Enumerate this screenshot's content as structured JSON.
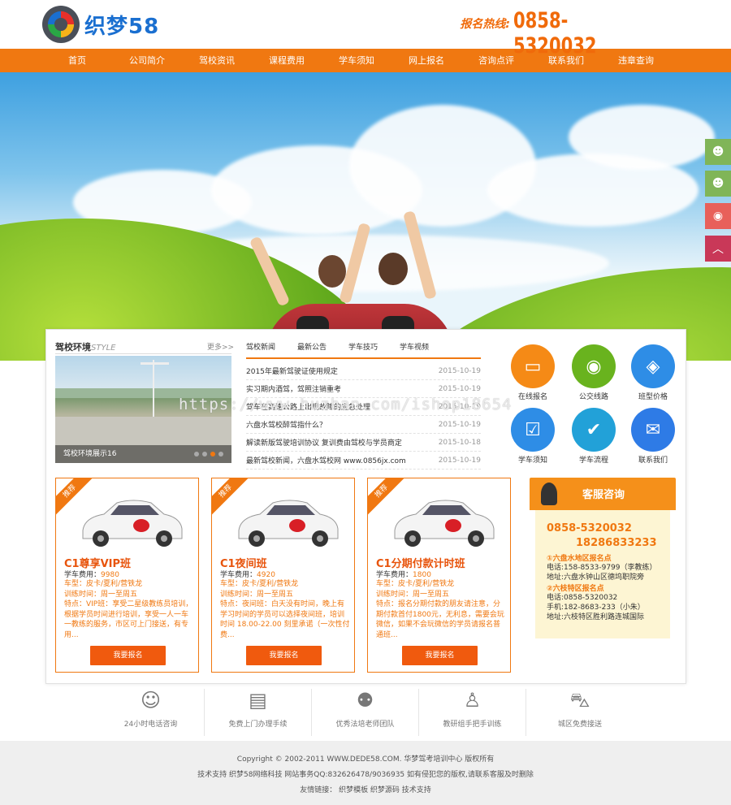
{
  "header": {
    "logo_text": "织梦58",
    "hotline_label": "报名热线:",
    "hotline_number": "0858-5320032"
  },
  "nav": {
    "items": [
      "首页",
      "公司简介",
      "驾校资讯",
      "课程费用",
      "学车须知",
      "网上报名",
      "咨询点评",
      "联系我们",
      "违章查询"
    ]
  },
  "environment": {
    "title": "驾校环境",
    "title_en": "STYLE",
    "more": "更多>>",
    "caption": "驾校环境展示16"
  },
  "news": {
    "tabs": [
      "驾校新闻",
      "最新公告",
      "学车技巧",
      "学车视频"
    ],
    "items": [
      {
        "title": "2015年最新驾驶证使用规定",
        "date": "2015-10-19"
      },
      {
        "title": "实习期内酒驾，驾照注销重考",
        "date": "2015-10-19"
      },
      {
        "title": "驾车在高速公路上出现故障的应急处理",
        "date": "2015-10-19"
      },
      {
        "title": "六盘水驾校醉驾指什么？",
        "date": "2015-10-19"
      },
      {
        "title": "解读新版驾驶培训协议 复训费由驾校与学员商定",
        "date": "2015-10-18"
      },
      {
        "title": "最新驾校新闻，六盘水驾校网 www.0856jx.com",
        "date": "2015-10-19"
      }
    ]
  },
  "quick_icons": [
    {
      "label": "在线报名",
      "color": "#f58a16"
    },
    {
      "label": "公交线路",
      "color": "#69b31e"
    },
    {
      "label": "班型价格",
      "color": "#2e8de6"
    },
    {
      "label": "学车须知",
      "color": "#2e8de6"
    },
    {
      "label": "学车流程",
      "color": "#22a1d8"
    },
    {
      "label": "联系我们",
      "color": "#2e7be6"
    }
  ],
  "courses": [
    {
      "badge": "推荐",
      "title": "C1尊享VIP班",
      "price_label": "学车费用：",
      "price": "9980",
      "car": "车型：皮卡/夏利/营铁龙",
      "time": "训练时间：周一至周五",
      "desc": "特点：VIP班：享受二星级教练员培训，根据学员时间进行培训，享受一人一车一教练的服务，市区可上门接送，有专用...",
      "button": "我要报名"
    },
    {
      "badge": "推荐",
      "title": "C1夜间班",
      "price_label": "学车费用：",
      "price": "4920",
      "car": "车型：皮卡/夏利/营铁龙",
      "time": "训练时间：周一至周五",
      "desc": "特点：夜间班：白天没有时间，晚上有学习时间的学员可以选择夜间班，培训时间 18.00-22.00 刻里承诺（一次性付费...",
      "button": "我要报名"
    },
    {
      "badge": "推荐",
      "title": "C1分期付款计时班",
      "price_label": "学车费用：",
      "price": "1800",
      "car": "车型：皮卡/夏利/营铁龙",
      "time": "训练时间：周一至周五",
      "desc": "特点：报名分期付款的朋友请注意，分期付款首付1800元，无利息，需要会玩微信，如果不会玩微信的学员请报名普通班...",
      "button": "我要报名"
    }
  ],
  "service": {
    "title": "客服咨询",
    "phone1": "0858-5320032",
    "phone2": "18286833233",
    "branch1": "①六盘水地区报名点",
    "b1_phone": "电话:158-8533-9799（李教练）",
    "b1_addr": "地址:六盘水钟山区德坞职院旁",
    "branch2": "②六枝特区报名点",
    "b2_phone": "电话:0858-5320032",
    "b2_mobile": "手机:182-8683-233（小朱）",
    "b2_addr": "地址:六枝特区胜利路连城国际"
  },
  "features": [
    "24小时电话咨询",
    "免费上门办理手续",
    "优秀法培老师团队",
    "教研组手把手训练",
    "城区免费接送"
  ],
  "footer": {
    "copyright": "Copyright © 2002-2011 WWW.DEDE58.COM. 华梦驾考培训中心 版权所有",
    "support": "技术支持 织梦58网络科技 网站事务QQ:832626478/9036935 如有侵犯您的版权,请联系客服及时删除",
    "links": "友情链接： 织梦模板 织梦源码 技术支持"
  },
  "watermark": "https://www.huzhan.com/ishop18654"
}
